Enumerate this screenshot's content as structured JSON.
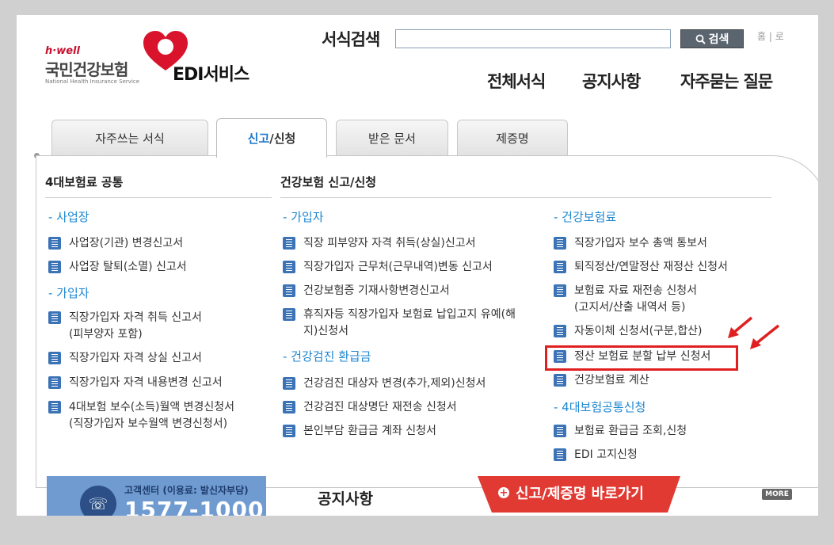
{
  "brand": {
    "tag": "h·well",
    "name_ko": "국민건강보험",
    "name_en": "National Health Insurance Service",
    "service": "EDI서비스"
  },
  "header": {
    "search_label": "서식검색",
    "search_value": "",
    "search_button": "검색",
    "util_links": "홈 | 로",
    "nav": [
      "전체서식",
      "공지사항",
      "자주묻는 질문"
    ]
  },
  "tabs": {
    "frequent": "자주쓰는 서식",
    "report_part1": "신고",
    "report_part2": "/신청",
    "received": "받은 문서",
    "certificate": "제증명"
  },
  "columns": {
    "common_title": "4대보험료 공통",
    "health_title": "건강보험 신고/신청"
  },
  "col1": {
    "sec1": "- 사업장",
    "items1": [
      "사업장(기관) 변경신고서",
      "사업장 탈퇴(소멸) 신고서"
    ],
    "sec2": "- 가입자",
    "items2": [
      "직장가입자 자격 취득 신고서\n(피부양자 포함)",
      "직장가입자 자격 상실 신고서",
      "직장가입자 자격 내용변경 신고서",
      "4대보험 보수(소득)월액 변경신청서\n(직장가입자 보수월액 변경신청서)"
    ]
  },
  "col2": {
    "sec1": "- 가입자",
    "items1": [
      "직장 피부양자 자격 취득(상실)신고서",
      "직장가입자 근무처(근무내역)변동 신고서",
      "건강보험증 기재사항변경신고서",
      "휴직자등 직장가입자 보험료 납입고지 유예(해\n지)신청서"
    ],
    "sec2": "- 건강검진 환급금",
    "items2": [
      "건강검진 대상자 변경(추가,제외)신청서",
      "건강검진 대상명단 재전송 신청서",
      "본인부담 환급금 계좌 신청서"
    ]
  },
  "col3": {
    "sec1": "- 건강보험료",
    "items1": [
      "직장가입자 보수 총액 통보서",
      "퇴직정산/연말정산 재정산 신청서",
      "보험료 자료 재전송 신청서\n(고지서/산출 내역서 등)",
      "자동이체 신청서(구분,합산)",
      "정산 보험료 분할 납부 신청서",
      "건강보험료 계산"
    ],
    "sec2": "- 4대보험공통신청",
    "items2": [
      "보험료 환급금 조회,신청",
      "EDI 고지신청"
    ]
  },
  "footer": {
    "cs_label": "고객센터 (이용료: 발신자부담)",
    "cs_number": "1577-1000",
    "notice": "공지사항",
    "quick": "신고/제증명 바로가기",
    "more": "MORE"
  },
  "colors": {
    "accent_blue": "#1d86d0",
    "highlight_red": "#e02020",
    "quick_red": "#e03a33",
    "cs_blue": "#6f9bd1"
  }
}
